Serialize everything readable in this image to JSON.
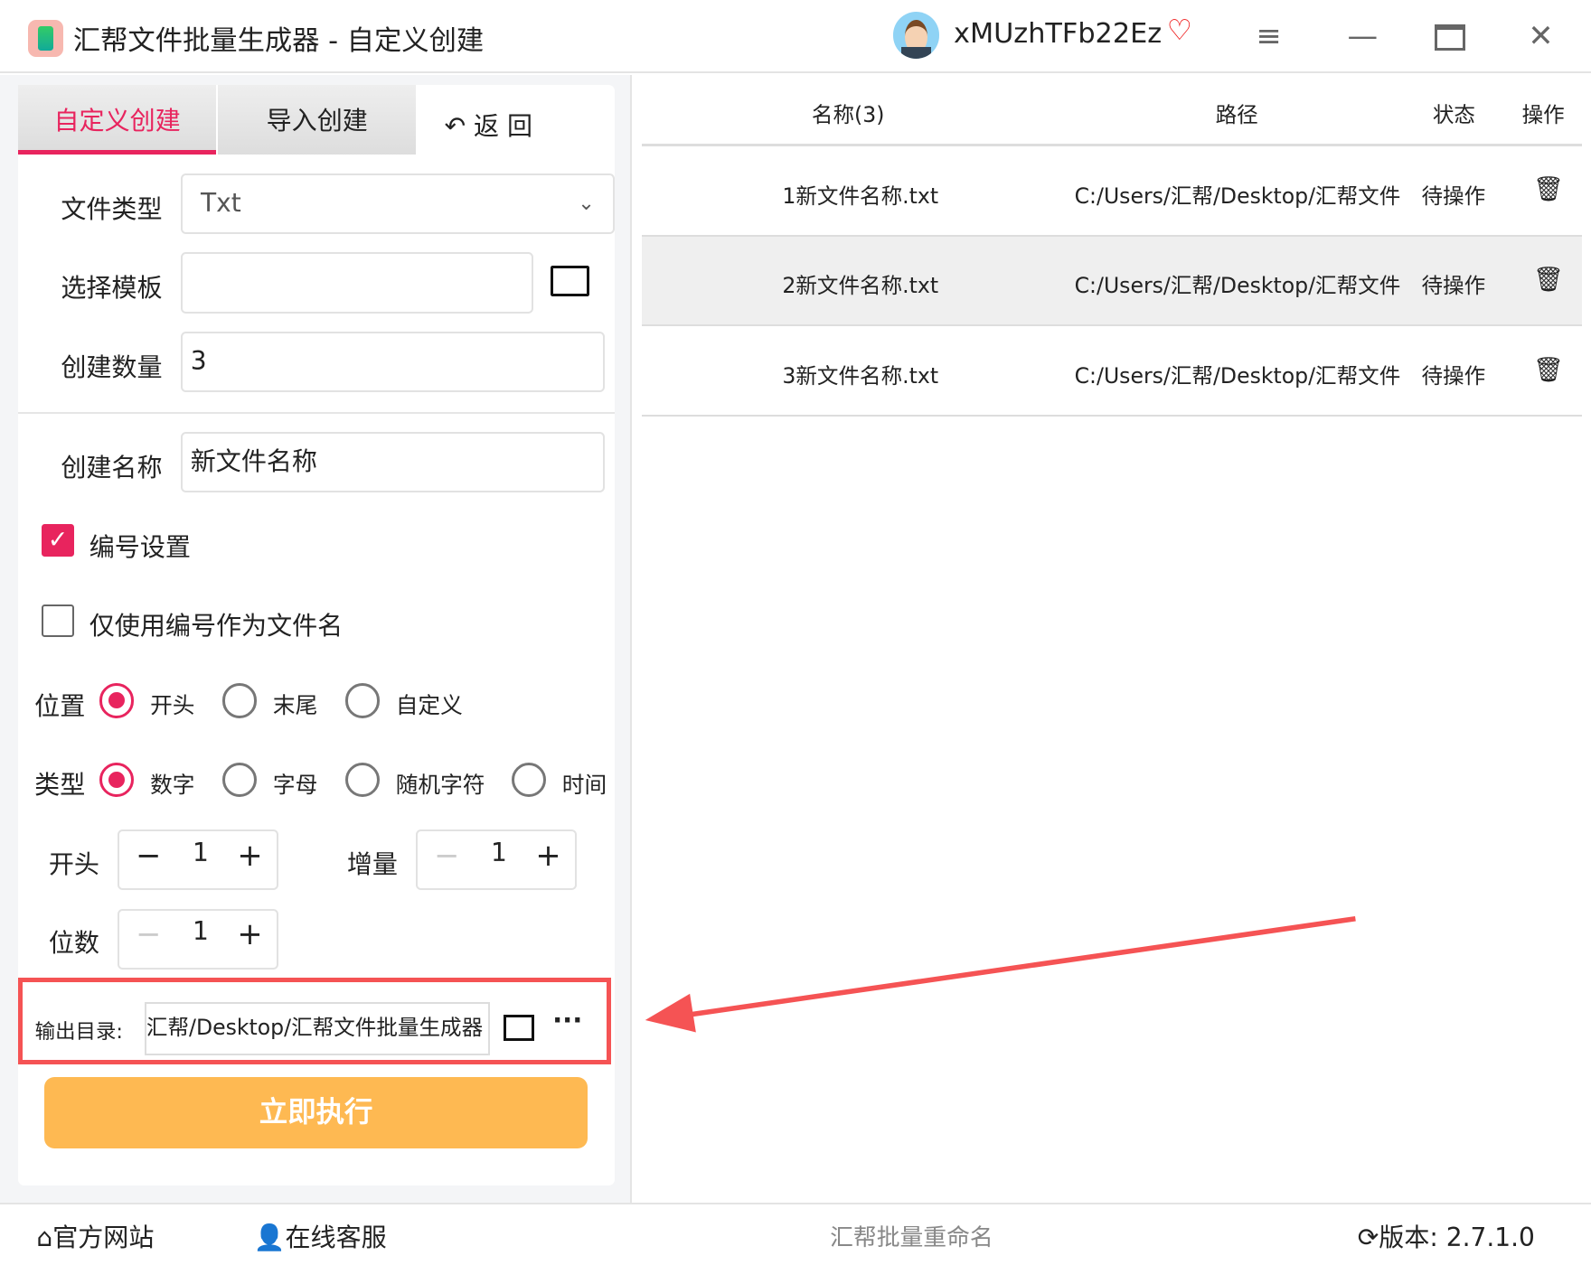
{
  "window": {
    "title": "汇帮文件批量生成器 - 自定义创建",
    "username": "xMUzhTFb22Ez",
    "icons": [
      "app-icon",
      "avatar",
      "vip-diamond-icon",
      "menu-icon",
      "minimize-icon",
      "maximize-icon",
      "close-icon"
    ]
  },
  "tabs": [
    {
      "label": "自定义创建",
      "active": true
    },
    {
      "label": "导入创建",
      "active": false
    }
  ],
  "back_label": "返 回",
  "form": {
    "file_type_label": "文件类型",
    "file_type_value": "Txt",
    "template_label": "选择模板",
    "template_value": "",
    "count_label": "创建数量",
    "count_value": "3",
    "name_label": "创建名称",
    "name_value": "新文件名称",
    "numbering_label": "编号设置",
    "numbering_checked": true,
    "only_number_label": "仅使用编号作为文件名",
    "only_number_checked": false,
    "position_label": "位置",
    "position_options": [
      "开头",
      "末尾",
      "自定义"
    ],
    "position_selected": "开头",
    "type_label": "类型",
    "type_options": [
      "数字",
      "字母",
      "随机字符",
      "时间"
    ],
    "type_selected": "数字",
    "start_label": "开头",
    "start_value": "1",
    "increment_label": "增量",
    "increment_value": "1",
    "digits_label": "位数",
    "digits_value": "1",
    "output_label": "输出目录:",
    "output_value": "汇帮/Desktop/汇帮文件批量生成器",
    "run_label": "立即执行"
  },
  "table": {
    "headers": [
      "名称(3)",
      "路径",
      "状态",
      "操作"
    ],
    "rows": [
      {
        "name": "1新文件名称.txt",
        "path": "C:/Users/汇帮/Desktop/汇帮文件",
        "status": "待操作"
      },
      {
        "name": "2新文件名称.txt",
        "path": "C:/Users/汇帮/Desktop/汇帮文件",
        "status": "待操作"
      },
      {
        "name": "3新文件名称.txt",
        "path": "C:/Users/汇帮/Desktop/汇帮文件",
        "status": "待操作"
      }
    ]
  },
  "footer": {
    "website": "官方网站",
    "support": "在线客服",
    "center": "汇帮批量重命名",
    "version_label": "版本:",
    "version": "2.7.1.0"
  },
  "colors": {
    "accent": "#e8245e",
    "run_button": "#feb952",
    "highlight_box": "#f55354"
  }
}
